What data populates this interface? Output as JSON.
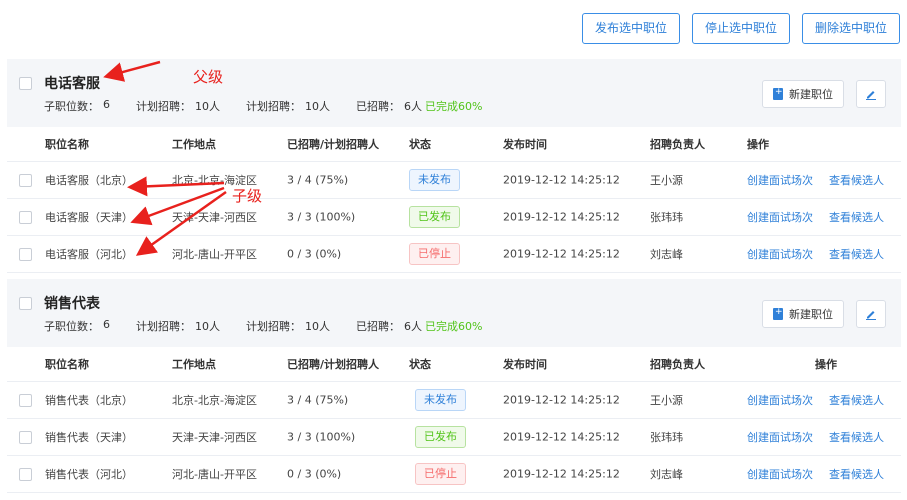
{
  "top_actions": {
    "publish": "发布选中职位",
    "stop": "停止选中职位",
    "delete": "删除选中职位"
  },
  "columns": [
    "职位名称",
    "工作地点",
    "已招聘/计划招聘人",
    "状态",
    "发布时间",
    "招聘负责人",
    "操作"
  ],
  "labels": {
    "sub_count": "子职位数：",
    "planned": "计划招聘：",
    "hired": "已招聘：",
    "new_position": "新建职位",
    "create_interview": "创建面试场次",
    "view_candidates": "查看候选人"
  },
  "annotations": {
    "parent": "父级",
    "child": "子级"
  },
  "colors": {
    "accent": "#2f80d8",
    "success": "#52c41a",
    "danger": "#f56c6c",
    "annotation": "#e8211d"
  },
  "groups": [
    {
      "title": "电话客服",
      "sub_count": "6",
      "planned_a": "10人",
      "planned_b": "10人",
      "hired": "6人",
      "done": "已完成60%",
      "rows": [
        {
          "name": "电话客服（北京）",
          "location": "北京-北京-海淀区",
          "progress": "3 / 4  (75%)",
          "status": "未发布",
          "status_color": "blue",
          "time": "2019-12-12  14:25:12",
          "owner": "王小源"
        },
        {
          "name": "电话客服（天津）",
          "location": "天津-天津-河西区",
          "progress": "3 / 3  (100%)",
          "status": "已发布",
          "status_color": "green",
          "time": "2019-12-12  14:25:12",
          "owner": "张玮玮"
        },
        {
          "name": "电话客服（河北）",
          "location": "河北-唐山-开平区",
          "progress": "0 / 3  (0%)",
          "status": "已停止",
          "status_color": "red",
          "time": "2019-12-12  14:25:12",
          "owner": "刘志峰"
        }
      ]
    },
    {
      "title": "销售代表",
      "sub_count": "6",
      "planned_a": "10人",
      "planned_b": "10人",
      "hired": "6人",
      "done": "已完成60%",
      "rows": [
        {
          "name": "销售代表（北京）",
          "location": "北京-北京-海淀区",
          "progress": "3 / 4  (75%)",
          "status": "未发布",
          "status_color": "blue",
          "time": "2019-12-12  14:25:12",
          "owner": "王小源"
        },
        {
          "name": "销售代表（天津）",
          "location": "天津-天津-河西区",
          "progress": "3 / 3  (100%)",
          "status": "已发布",
          "status_color": "green",
          "time": "2019-12-12  14:25:12",
          "owner": "张玮玮"
        },
        {
          "name": "销售代表（河北）",
          "location": "河北-唐山-开平区",
          "progress": "0 / 3  (0%)",
          "status": "已停止",
          "status_color": "red",
          "time": "2019-12-12  14:25:12",
          "owner": "刘志峰"
        }
      ]
    }
  ]
}
